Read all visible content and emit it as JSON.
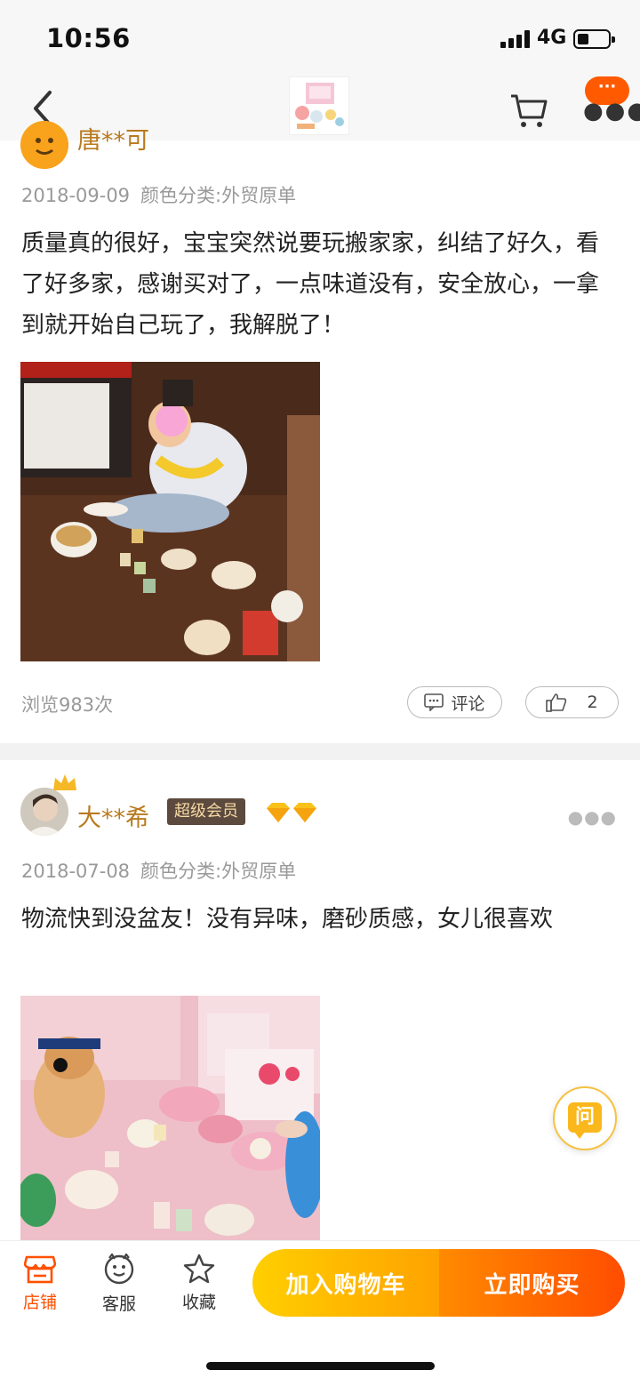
{
  "status_bar": {
    "time": "10:56",
    "network": "4G"
  },
  "reviews": [
    {
      "username": "唐**可",
      "date": "2018-09-09",
      "variant": "颜色分类:外贸原单",
      "content": "质量真的很好，宝宝突然说要玩搬家家，纠结了好久，看了好多家，感谢买对了，一点味道没有，安全放心，一拿到就开始自己玩了，我解脱了！",
      "views": "浏览983次",
      "comment_label": "评论",
      "likes": "2"
    },
    {
      "username": "大**希",
      "badge": "超级会员",
      "date": "2018-07-08",
      "variant": "颜色分类:外贸原单",
      "content": "物流快到没盆友！没有异味，磨砂质感，女儿很喜欢"
    }
  ],
  "nav": {
    "more_badge": "···"
  },
  "ask_button": {
    "label": "问"
  },
  "bottom_bar": {
    "tabs": [
      {
        "label": "店铺",
        "icon": "store-icon"
      },
      {
        "label": "客服",
        "icon": "customer-service-icon"
      },
      {
        "label": "收藏",
        "icon": "star-icon"
      }
    ],
    "add_to_cart": "加入购物车",
    "buy_now": "立即购买"
  },
  "colors": {
    "accent": "#ff5000",
    "username": "#b87a1d",
    "cart_gradient": [
      "#ffcf00",
      "#ffa200"
    ],
    "buy_gradient": [
      "#ff8a00",
      "#ff4d00"
    ]
  }
}
